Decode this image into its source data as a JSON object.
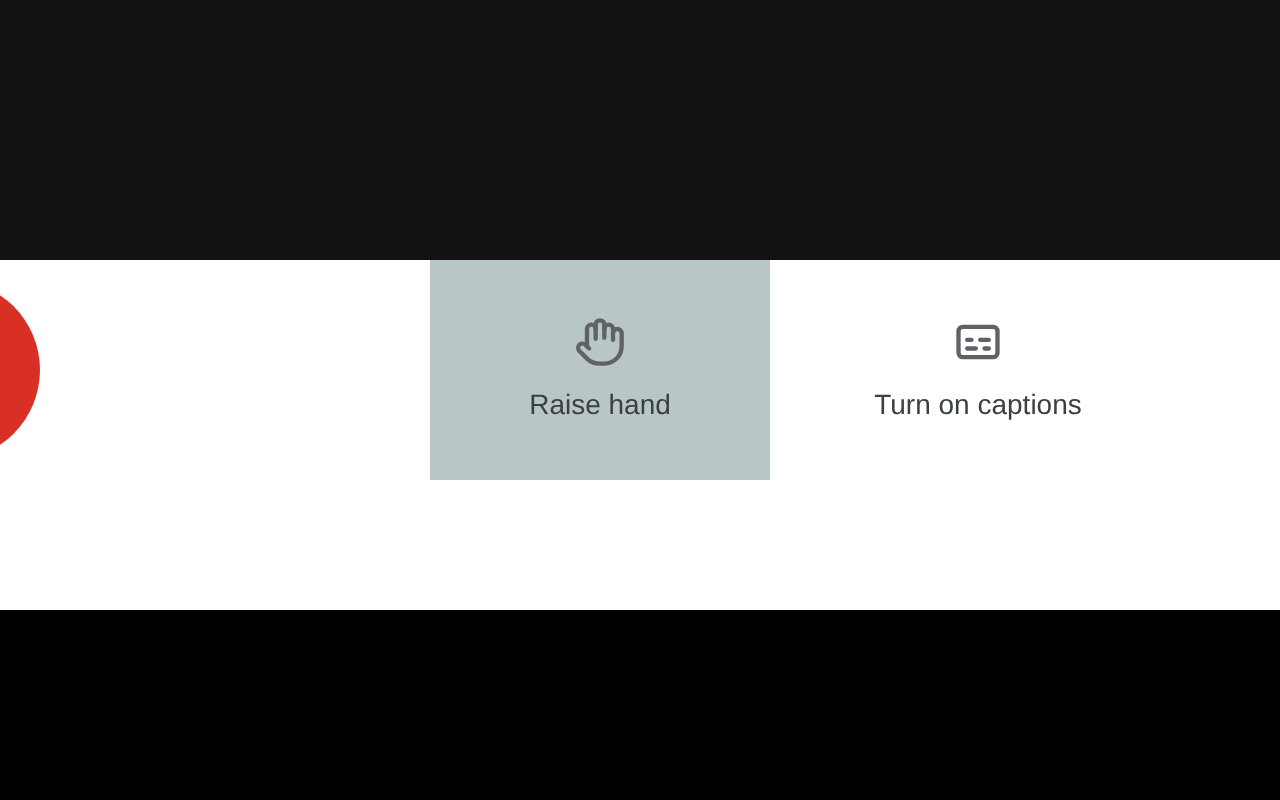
{
  "controls": [
    {
      "label": "Raise hand",
      "kind": "hand",
      "selected": true
    },
    {
      "label": "Turn on captions",
      "kind": "captions",
      "selected": false
    }
  ]
}
